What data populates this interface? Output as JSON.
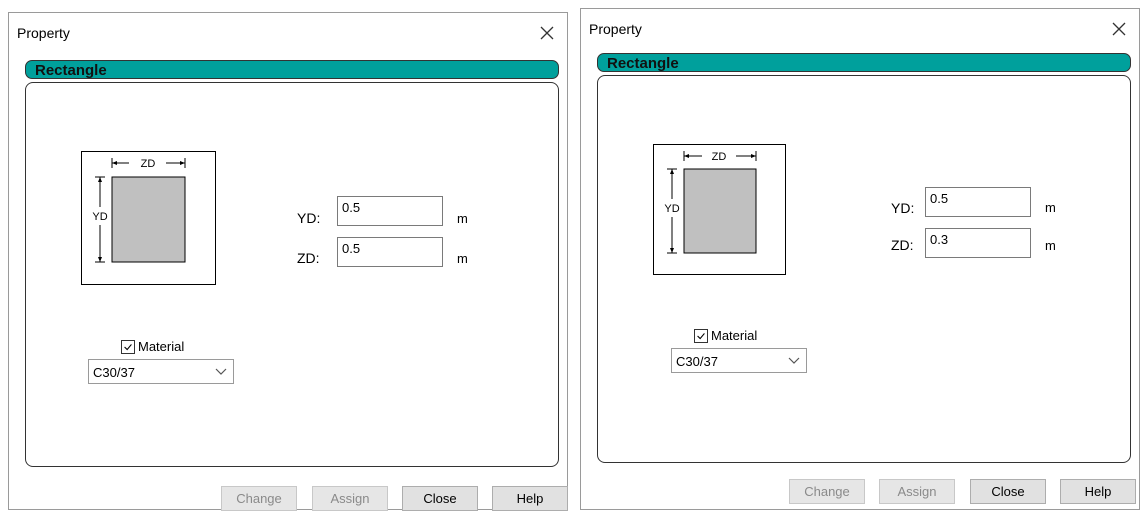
{
  "dialogs": [
    {
      "title": "Property",
      "section_label": "Rectangle",
      "diagram": {
        "width_label": "ZD",
        "height_label": "YD"
      },
      "fields": {
        "yd": {
          "label": "YD:",
          "value": "0.5",
          "unit": "m"
        },
        "zd": {
          "label": "ZD:",
          "value": "0.5",
          "unit": "m"
        }
      },
      "material": {
        "checked": true,
        "label": "Material",
        "selected": "C30/37"
      },
      "buttons": {
        "change": "Change",
        "assign": "Assign",
        "close": "Close",
        "help": "Help"
      }
    },
    {
      "title": "Property",
      "section_label": "Rectangle",
      "diagram": {
        "width_label": "ZD",
        "height_label": "YD"
      },
      "fields": {
        "yd": {
          "label": "YD:",
          "value": "0.5",
          "unit": "m"
        },
        "zd": {
          "label": "ZD:",
          "value": "0.3",
          "unit": "m"
        }
      },
      "material": {
        "checked": true,
        "label": "Material",
        "selected": "C30/37"
      },
      "buttons": {
        "change": "Change",
        "assign": "Assign",
        "close": "Close",
        "help": "Help"
      }
    }
  ],
  "colors": {
    "banner": "#00a09c",
    "section_fill": "#c0c0c0",
    "disabled_text": "#8a8a8a"
  }
}
